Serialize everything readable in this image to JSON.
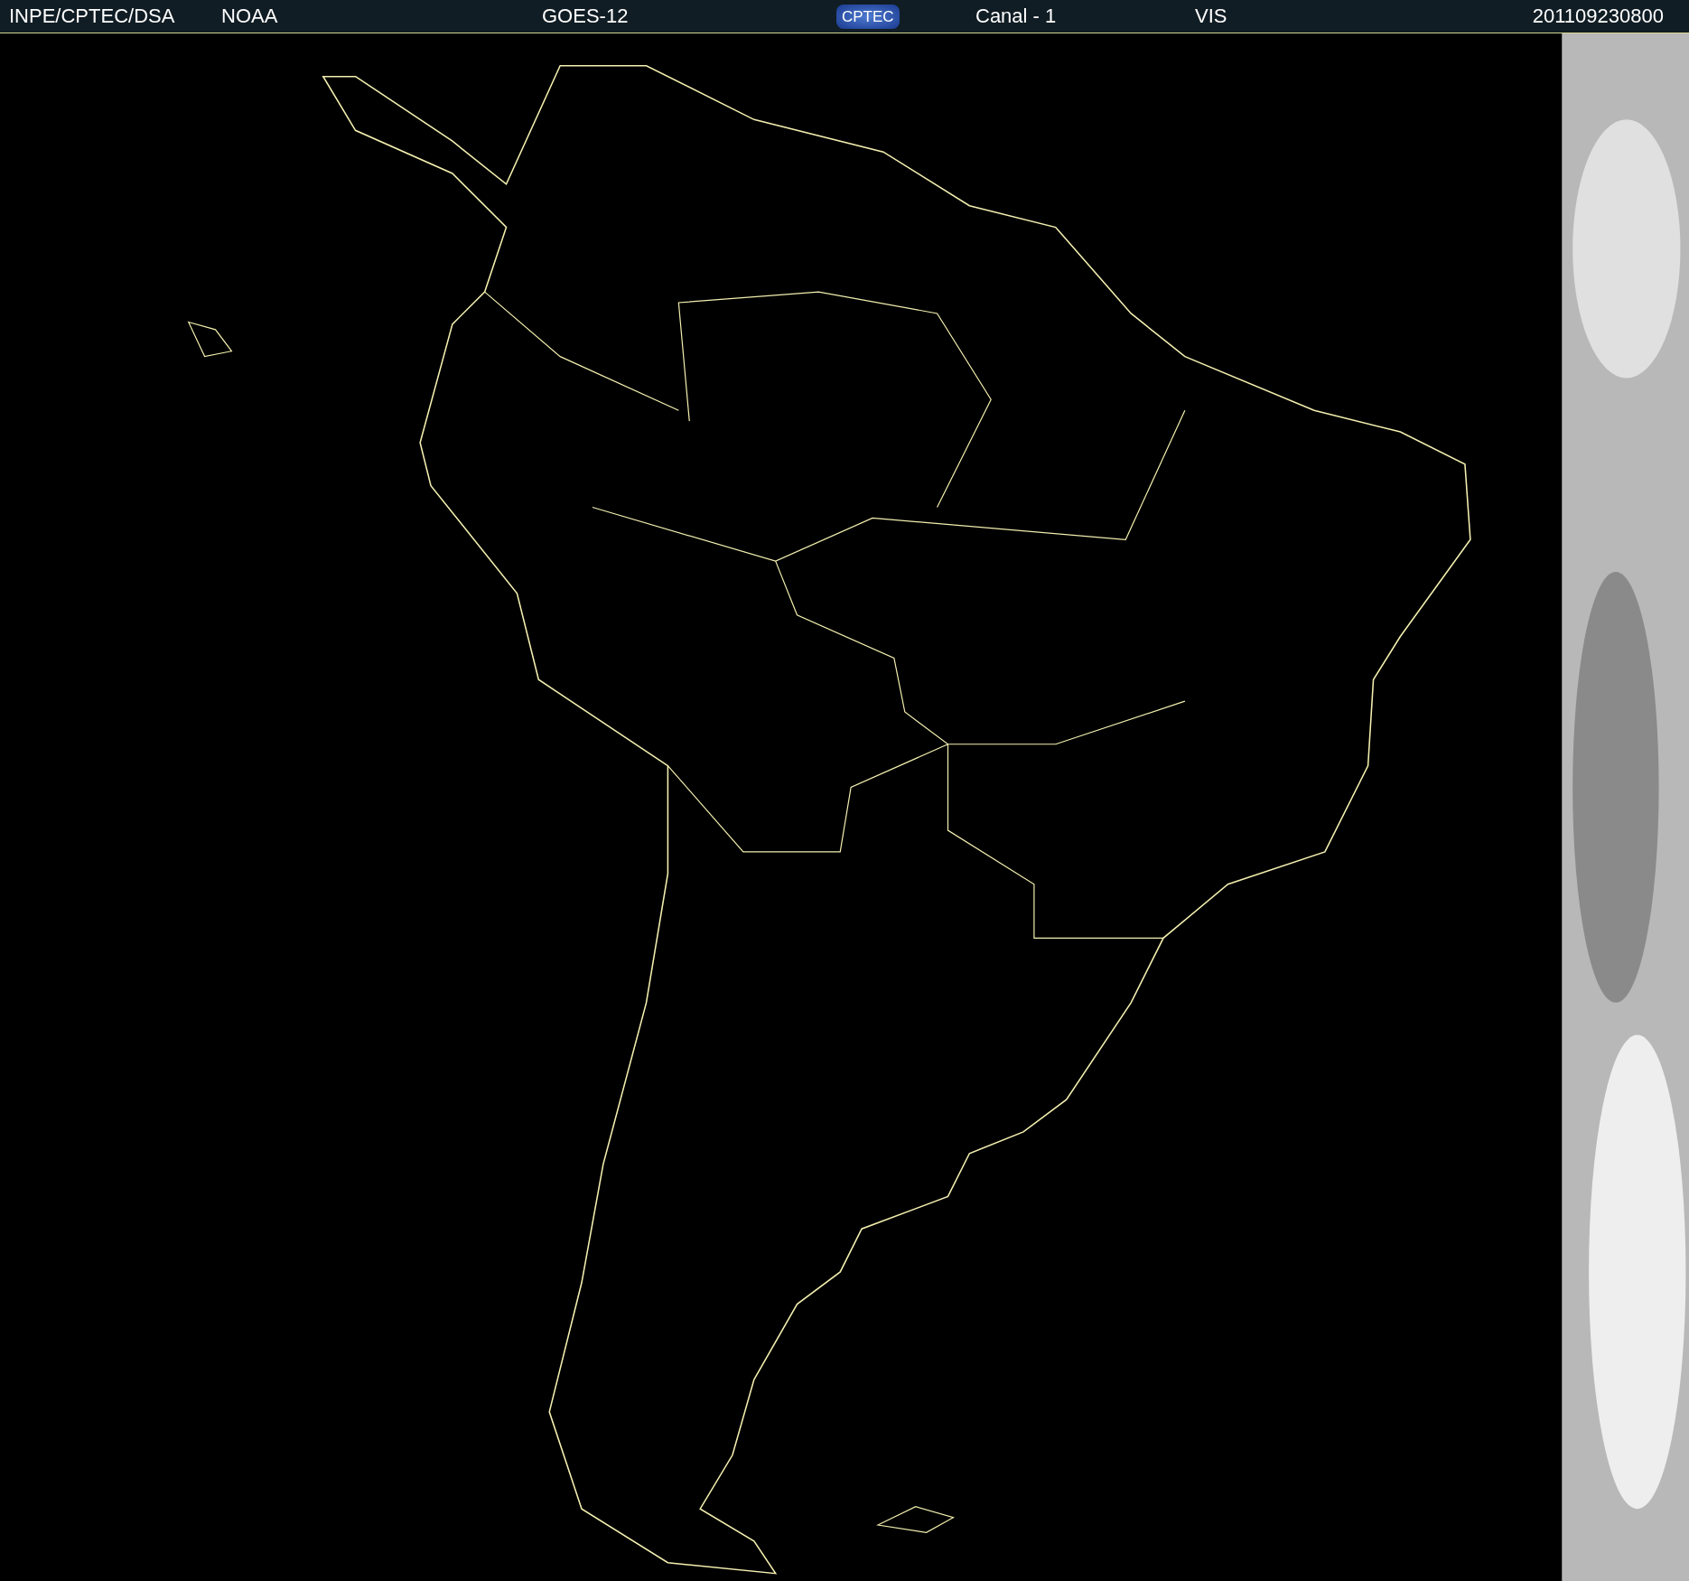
{
  "header": {
    "source": "INPE/CPTEC/DSA",
    "agency": "NOAA",
    "satellite": "GOES-12",
    "logo": "CPTEC",
    "channel": "Canal - 1",
    "band": "VIS",
    "timestamp": "201109230800"
  }
}
